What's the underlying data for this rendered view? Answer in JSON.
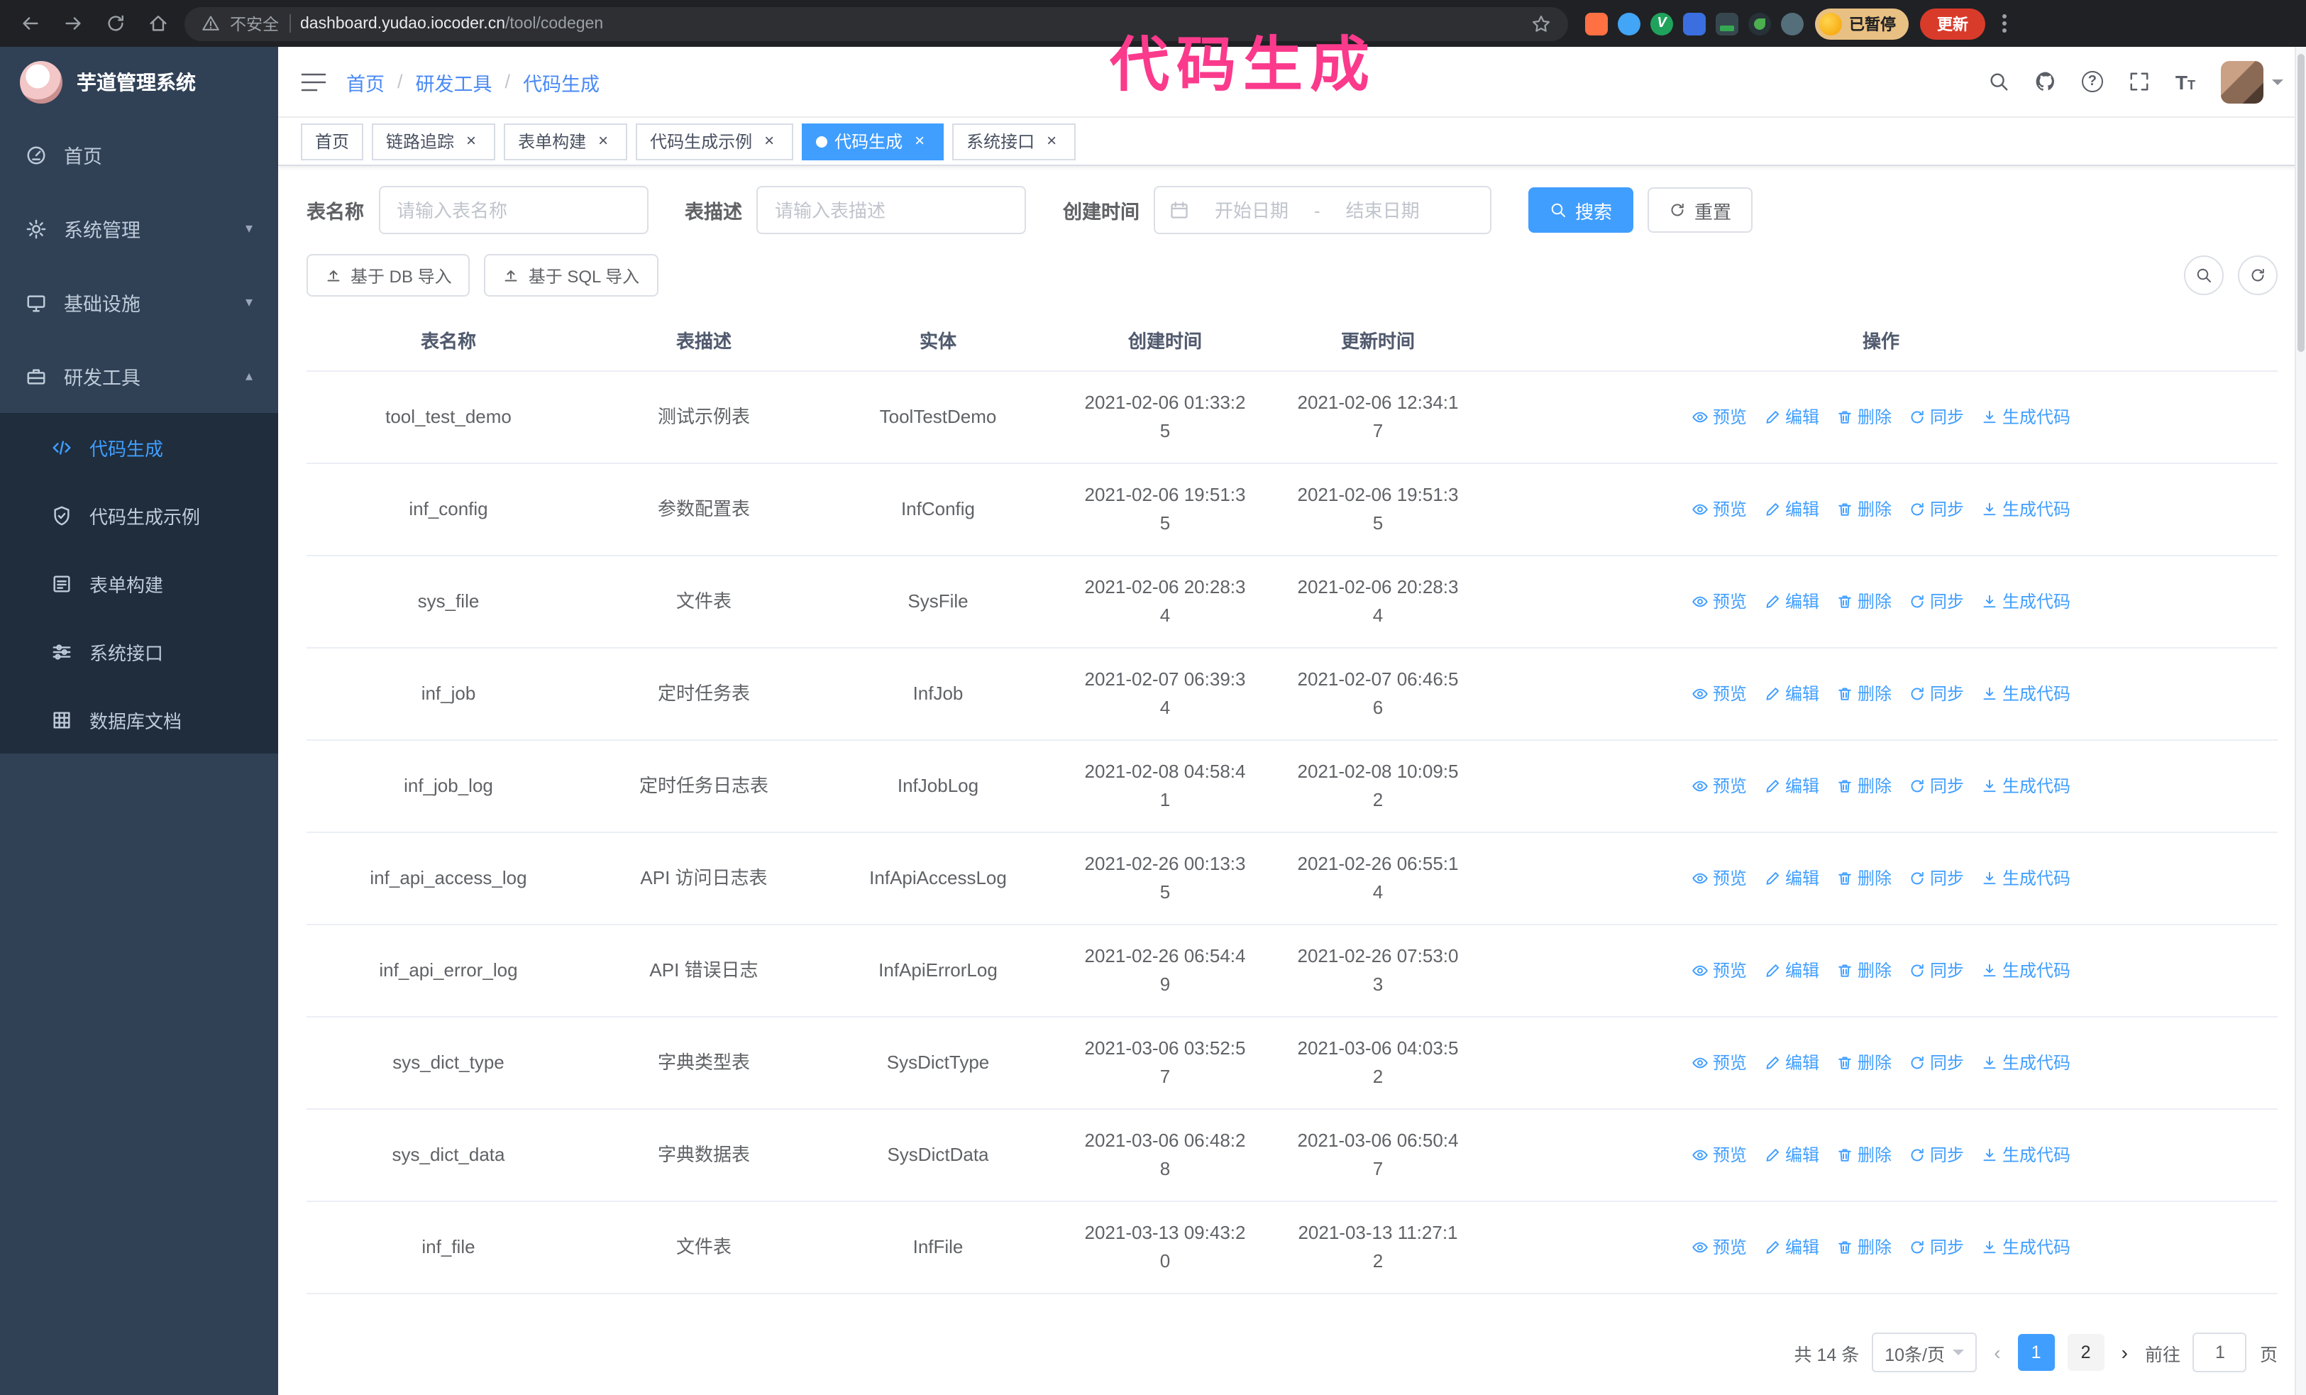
{
  "annotation": {
    "text": "代码生成",
    "color": "#fb3a8c"
  },
  "colors": {
    "accent": "#409EFF",
    "sidebar_bg": "#304156",
    "submenu_bg": "#1f2d3d",
    "update_button_bg": "#d93b2b",
    "profile_chip_bg": "#e9c083"
  },
  "browser": {
    "security_label": "不安全",
    "url_host": "dashboard.yudao.iocoder.cn",
    "url_path": "/tool/codegen",
    "profile_badge": "已暂停",
    "update_button": "更新"
  },
  "sidebar": {
    "app_title": "芋道管理系统",
    "items": [
      {
        "label": "首页",
        "icon": "dashboard-icon"
      },
      {
        "label": "系统管理",
        "icon": "gear-icon",
        "expandable": true
      },
      {
        "label": "基础设施",
        "icon": "monitor-icon",
        "expandable": true
      },
      {
        "label": "研发工具",
        "icon": "toolbox-icon",
        "expanded": true
      }
    ],
    "submenu": [
      {
        "label": "代码生成",
        "icon": "code-icon",
        "active": true
      },
      {
        "label": "代码生成示例",
        "icon": "shield-icon"
      },
      {
        "label": "表单构建",
        "icon": "form-icon"
      },
      {
        "label": "系统接口",
        "icon": "sliders-icon"
      },
      {
        "label": "数据库文档",
        "icon": "grid-icon"
      }
    ]
  },
  "header": {
    "breadcrumb": [
      "首页",
      "研发工具",
      "代码生成"
    ]
  },
  "tabs": [
    {
      "label": "首页",
      "closable": false,
      "active": false
    },
    {
      "label": "链路追踪",
      "closable": true,
      "active": false
    },
    {
      "label": "表单构建",
      "closable": true,
      "active": false
    },
    {
      "label": "代码生成示例",
      "closable": true,
      "active": false
    },
    {
      "label": "代码生成",
      "closable": true,
      "active": true
    },
    {
      "label": "系统接口",
      "closable": true,
      "active": false
    }
  ],
  "filters": {
    "table_name_label": "表名称",
    "table_name_placeholder": "请输入表名称",
    "table_desc_label": "表描述",
    "table_desc_placeholder": "请输入表描述",
    "create_time_label": "创建时间",
    "date_start_placeholder": "开始日期",
    "date_separator": "-",
    "date_end_placeholder": "结束日期",
    "search_button": "搜索",
    "reset_button": "重置"
  },
  "toolbar": {
    "import_db": "基于 DB 导入",
    "import_sql": "基于 SQL 导入"
  },
  "table": {
    "columns": [
      "表名称",
      "表描述",
      "实体",
      "创建时间",
      "更新时间",
      "操作"
    ],
    "actions": [
      "预览",
      "编辑",
      "删除",
      "同步",
      "生成代码"
    ],
    "rows": [
      {
        "name": "tool_test_demo",
        "desc": "测试示例表",
        "entity": "ToolTestDemo",
        "created": "2021-02-06 01:33:25",
        "updated": "2021-02-06 12:34:17"
      },
      {
        "name": "inf_config",
        "desc": "参数配置表",
        "entity": "InfConfig",
        "created": "2021-02-06 19:51:35",
        "updated": "2021-02-06 19:51:35"
      },
      {
        "name": "sys_file",
        "desc": "文件表",
        "entity": "SysFile",
        "created": "2021-02-06 20:28:34",
        "updated": "2021-02-06 20:28:34"
      },
      {
        "name": "inf_job",
        "desc": "定时任务表",
        "entity": "InfJob",
        "created": "2021-02-07 06:39:34",
        "updated": "2021-02-07 06:46:56"
      },
      {
        "name": "inf_job_log",
        "desc": "定时任务日志表",
        "entity": "InfJobLog",
        "created": "2021-02-08 04:58:41",
        "updated": "2021-02-08 10:09:52"
      },
      {
        "name": "inf_api_access_log",
        "desc": "API 访问日志表",
        "entity": "InfApiAccessLog",
        "created": "2021-02-26 00:13:35",
        "updated": "2021-02-26 06:55:14"
      },
      {
        "name": "inf_api_error_log",
        "desc": "API 错误日志",
        "entity": "InfApiErrorLog",
        "created": "2021-02-26 06:54:49",
        "updated": "2021-02-26 07:53:03"
      },
      {
        "name": "sys_dict_type",
        "desc": "字典类型表",
        "entity": "SysDictType",
        "created": "2021-03-06 03:52:57",
        "updated": "2021-03-06 04:03:52"
      },
      {
        "name": "sys_dict_data",
        "desc": "字典数据表",
        "entity": "SysDictData",
        "created": "2021-03-06 06:48:28",
        "updated": "2021-03-06 06:50:47"
      },
      {
        "name": "inf_file",
        "desc": "文件表",
        "entity": "InfFile",
        "created": "2021-03-13 09:43:20",
        "updated": "2021-03-13 11:27:12"
      }
    ]
  },
  "pagination": {
    "total": "共 14 条",
    "page_size": "10条/页",
    "pages": [
      "1",
      "2"
    ],
    "active_page": "1",
    "goto_label": "前往",
    "goto_value": "1",
    "goto_suffix": "页"
  }
}
